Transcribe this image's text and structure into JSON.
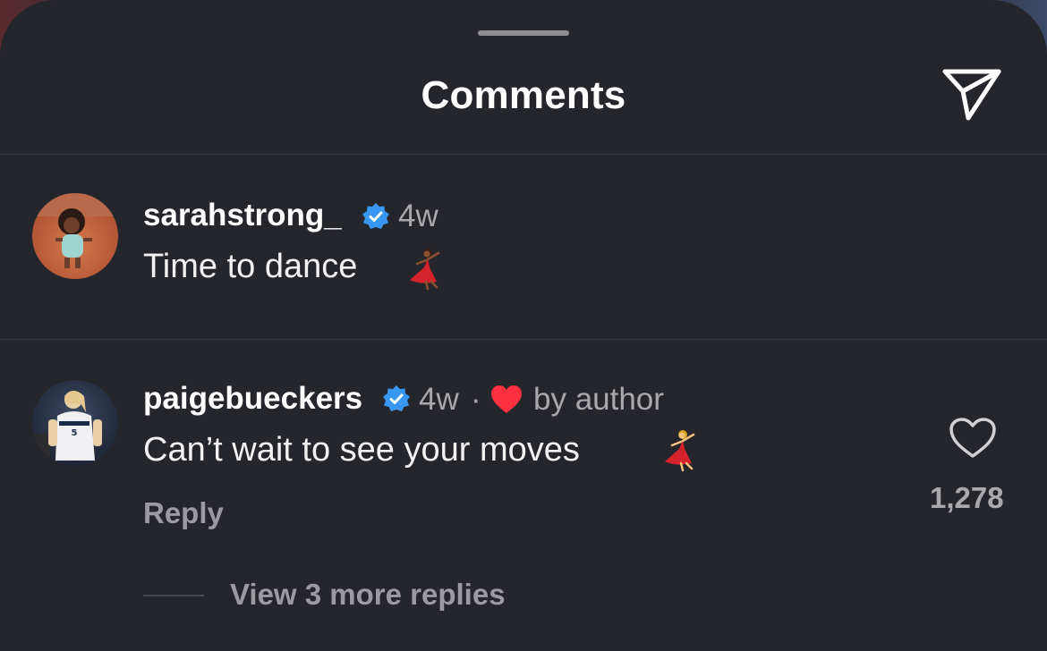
{
  "header": {
    "title": "Comments",
    "share_icon": "paper-plane-icon"
  },
  "comments": [
    {
      "username": "sarahstrong_",
      "verified": true,
      "time": "4w",
      "text": "Time to dance",
      "emoji": "woman-dancing-emoji"
    },
    {
      "username": "paigebueckers",
      "verified": true,
      "time": "4w",
      "separator": "·",
      "liked_by_author": "by author",
      "text": "Can’t wait to see your moves",
      "emoji": "woman-dancing-emoji",
      "reply_label": "Reply",
      "like_count": "1,278",
      "view_replies": "View 3 more replies"
    }
  ],
  "colors": {
    "sheet_bg": "#25262b",
    "verified_blue": "#3897f0",
    "heart_red": "#ff3040",
    "muted_text": "#a8a8ad"
  }
}
